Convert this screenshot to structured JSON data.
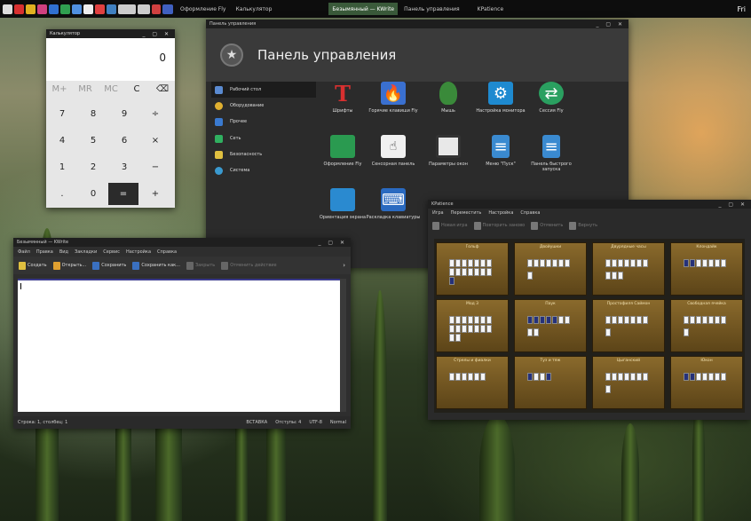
{
  "taskbar": {
    "tasks": [
      "Оформление Fly",
      "Калькулятор",
      "Безымянный — KWrite",
      "Панель управления",
      "KPatience"
    ],
    "active_task": 2,
    "clock": "Fri"
  },
  "calculator": {
    "title": "Калькулятор",
    "display": "0",
    "keys": [
      [
        "M+",
        "MR",
        "MC",
        "C",
        "⌫"
      ],
      [
        "7",
        "8",
        "9",
        "÷"
      ],
      [
        "4",
        "5",
        "6",
        "×"
      ],
      [
        "1",
        "2",
        "3",
        "−"
      ],
      [
        ".",
        "0",
        "=",
        "+"
      ]
    ]
  },
  "control_panel": {
    "window_title": "Панель управления",
    "heading": "Панель управления",
    "sidebar": [
      "Рабочий стол",
      "Оборудование",
      "Прочее",
      "Сеть",
      "Безопасность",
      "Система"
    ],
    "selected_index": 0,
    "items": [
      "Шрифты",
      "Горячие клавиши Fly",
      "Мышь",
      "Настройка монитора",
      "Сессия Fly",
      "Оформление Fly",
      "Сенсорная панель",
      "Параметры окон",
      "Меню \"Пуск\"",
      "Панель быстрого запуска",
      "Ориентация экрана",
      "Раскладка клавиатуры"
    ]
  },
  "kwrite": {
    "title": "Безымянный — KWrite",
    "menu": [
      "Файл",
      "Правка",
      "Вид",
      "Закладки",
      "Сервис",
      "Настройка",
      "Справка"
    ],
    "toolbar": {
      "new": "Создать",
      "open": "Открыть...",
      "save": "Сохранить",
      "save_as": "Сохранить как...",
      "close": "Закрыть",
      "undo": "Отменить действие"
    },
    "status": {
      "position": "Строка: 1, столбец: 1",
      "mode": "ВСТАВКА",
      "indent": "Отступы: 4",
      "encoding": "UTF-8",
      "syntax": "Normal"
    }
  },
  "kpatience": {
    "title": "KPatience",
    "menu": [
      "Игра",
      "Переместить",
      "Настройка",
      "Справка"
    ],
    "toolbar": {
      "new_game": "Новая игра",
      "restart": "Повторить заново",
      "undo": "Отменить",
      "redo": "Вернуть"
    },
    "games": [
      "Гольф",
      "Двойушки",
      "Двурядные часы",
      "Клондайк",
      "Мод 3",
      "Паук",
      "Простофиля Саймон",
      "Свободная ячейка",
      "Стрелы и фиалки",
      "Туз и тяж",
      "Цыганский",
      "Юкон"
    ]
  },
  "colors": {
    "cp_bg": "#2b2b2b",
    "calc_eq": "#2b2b2b",
    "kw_accent": "#3a3a8a",
    "felt": "#7a5a22"
  }
}
